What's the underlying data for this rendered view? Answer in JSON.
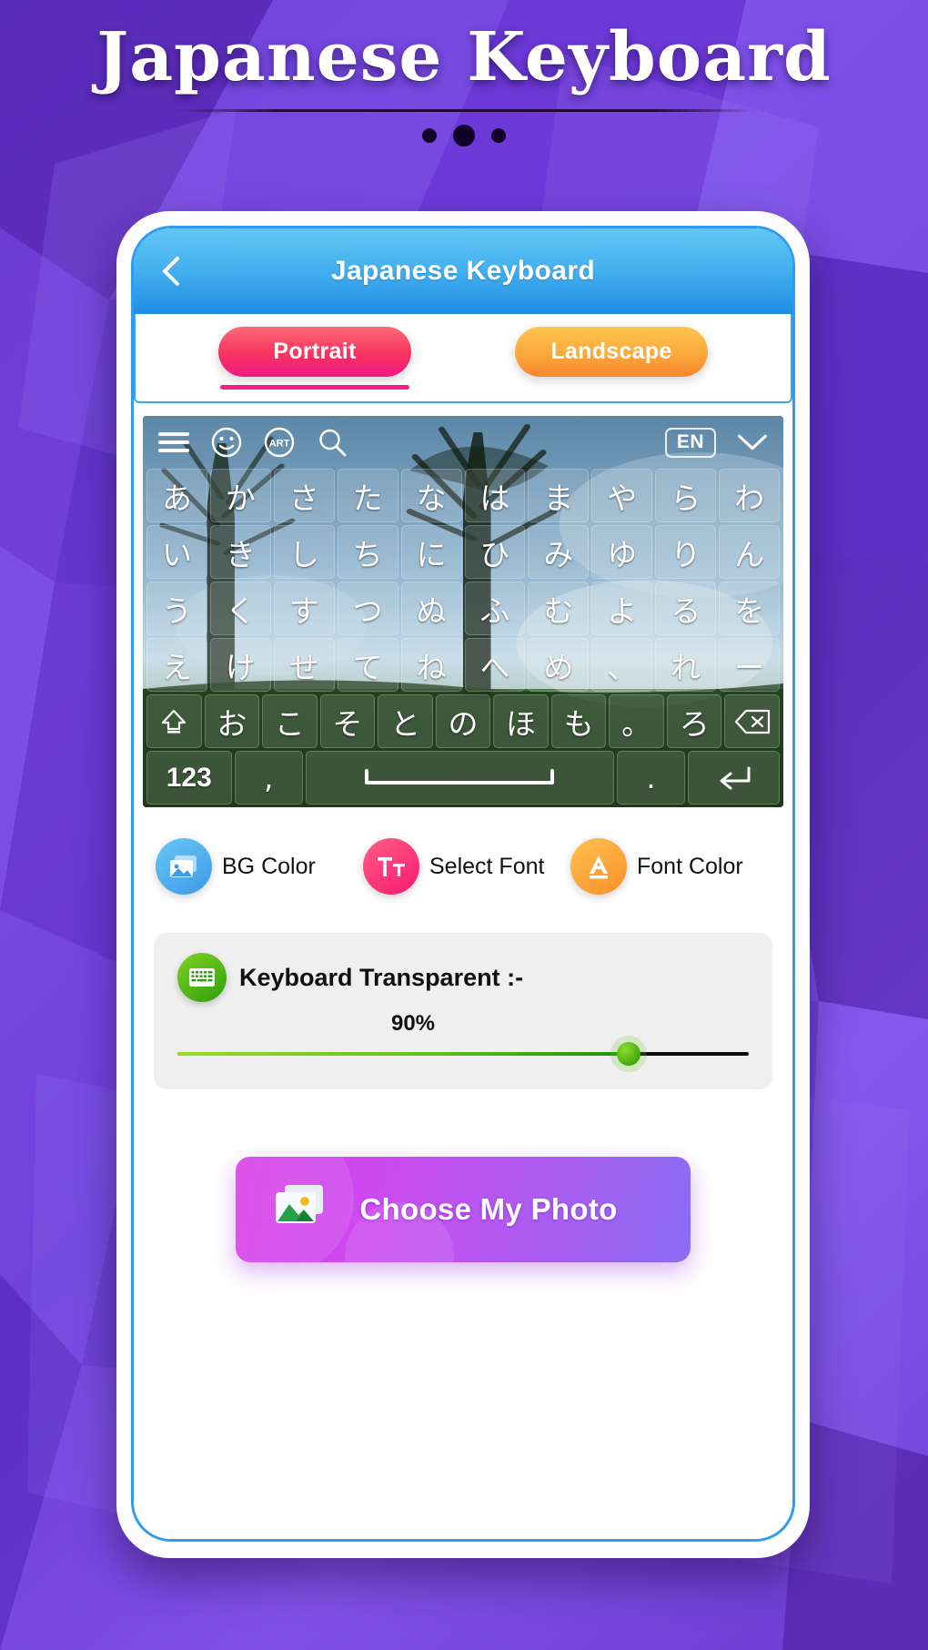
{
  "promo": {
    "title": "Japanese Keyboard",
    "dots": [
      "dot",
      "dot-active",
      "dot"
    ]
  },
  "app": {
    "header": {
      "back_icon": "chevron-left-icon",
      "title": "Japanese Keyboard"
    },
    "tabs": [
      {
        "label": "Portrait",
        "active": true
      },
      {
        "label": "Landscape",
        "active": false
      }
    ],
    "keyboard_preview": {
      "toolbar": {
        "icons": [
          "menu-icon",
          "emoji-icon",
          "art-icon",
          "search-icon"
        ],
        "art_label": "ART",
        "language_badge": "EN",
        "collapse_icon": "chevron-down-icon"
      },
      "rows": [
        [
          "あ",
          "か",
          "さ",
          "た",
          "な",
          "は",
          "ま",
          "や",
          "ら",
          "わ"
        ],
        [
          "い",
          "き",
          "し",
          "ち",
          "に",
          "ひ",
          "み",
          "ゆ",
          "り",
          "ん"
        ],
        [
          "う",
          "く",
          "す",
          "つ",
          "ぬ",
          "ふ",
          "む",
          "よ",
          "る",
          "を"
        ],
        [
          "え",
          "け",
          "せ",
          "て",
          "ね",
          "へ",
          "め",
          "、",
          "れ",
          "ー"
        ],
        [
          "⇧",
          "お",
          "こ",
          "そ",
          "と",
          "の",
          "ほ",
          "も",
          "。",
          "ろ",
          "⌫"
        ],
        [
          "123",
          ",",
          " ",
          ".",
          "⏎"
        ]
      ]
    },
    "options": [
      {
        "label": "BG Color",
        "icon": "image-icon",
        "color": "#3d9ae8"
      },
      {
        "label": "Select Font",
        "icon": "text-format-icon",
        "color": "#f81a6f"
      },
      {
        "label": "Font Color",
        "icon": "font-color-icon",
        "color": "#f98f2c"
      }
    ],
    "transparency": {
      "icon": "keyboard-icon",
      "label": "Keyboard Transparent :-",
      "value_label": "90%",
      "value": 90,
      "min": 0,
      "max": 100,
      "fill_color": "#5bbf14"
    },
    "cta": {
      "label": "Choose My Photo",
      "icon": "photo-icon"
    }
  },
  "colors": {
    "background": "#6b3fd4",
    "header_blue": "#2e9bf0",
    "tab_active": "#f51f8a",
    "tab_inactive": "#f98f2c",
    "cta_gradient_start": "#d93fe8",
    "cta_gradient_end": "#8b6cf4"
  }
}
